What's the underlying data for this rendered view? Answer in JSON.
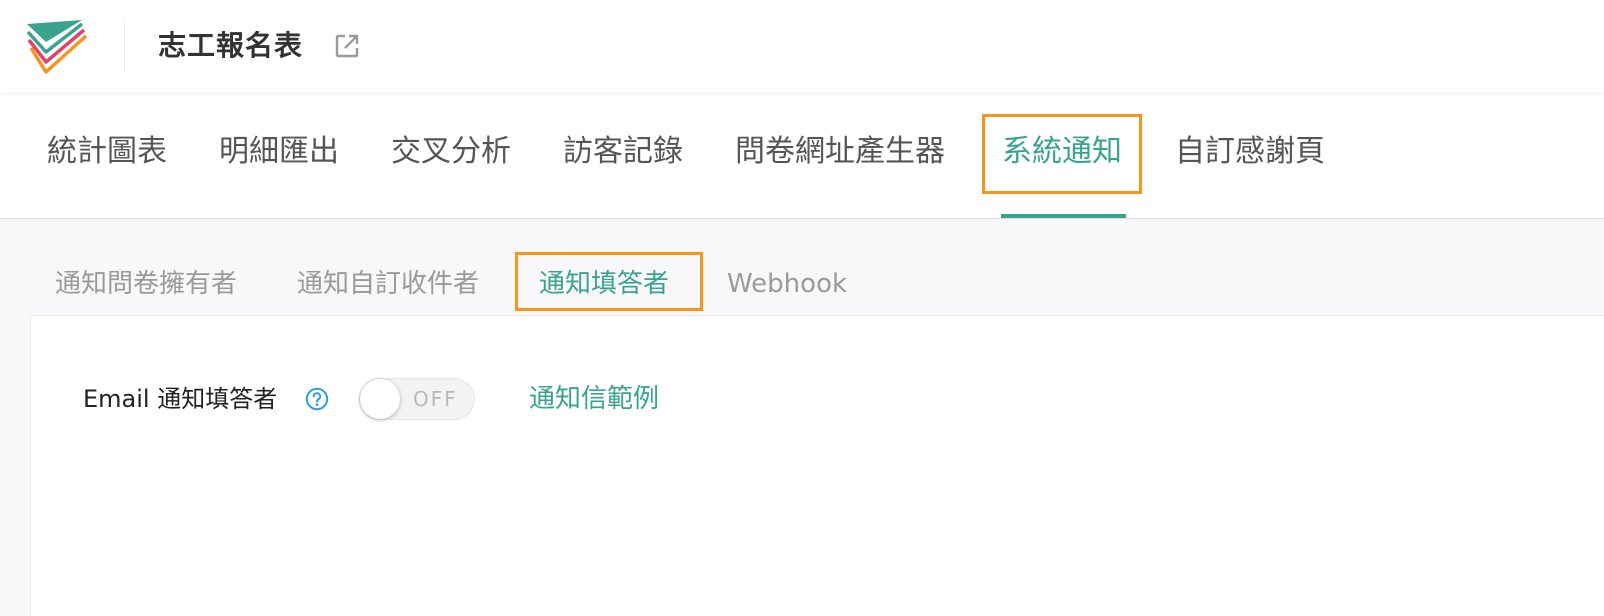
{
  "header": {
    "title": "志工報名表",
    "open_icon": "external-link-icon"
  },
  "main_tabs": [
    {
      "label": "統計圖表"
    },
    {
      "label": "明細匯出"
    },
    {
      "label": "交叉分析"
    },
    {
      "label": "訪客記錄"
    },
    {
      "label": "問卷網址產生器"
    },
    {
      "label": "系統通知",
      "active": true
    },
    {
      "label": "自訂感謝頁"
    }
  ],
  "sub_tabs": [
    {
      "label": "通知問卷擁有者"
    },
    {
      "label": "通知自訂收件者"
    },
    {
      "label": "通知填答者",
      "active": true
    },
    {
      "label": "Webhook"
    }
  ],
  "notify_respondent": {
    "label": "Email 通知填答者",
    "help_icon": "question-circle-icon",
    "toggle_state": "OFF",
    "example_link": "通知信範例"
  },
  "colors": {
    "accent": "#3aa38f",
    "highlight": "#f5951e",
    "help": "#2b9fd9"
  }
}
